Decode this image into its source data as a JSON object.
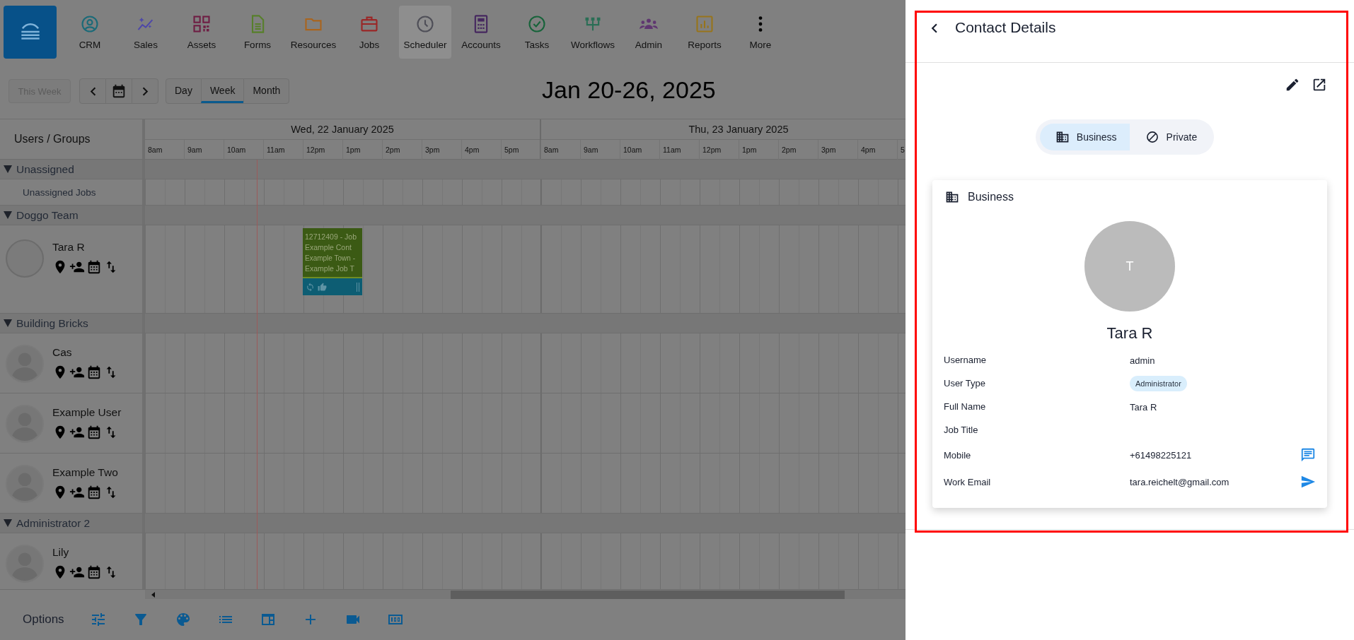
{
  "nav": {
    "items": [
      {
        "label": "CRM",
        "selected": false
      },
      {
        "label": "Sales",
        "selected": false
      },
      {
        "label": "Assets",
        "selected": false
      },
      {
        "label": "Forms",
        "selected": false
      },
      {
        "label": "Resources",
        "selected": false
      },
      {
        "label": "Jobs",
        "selected": false
      },
      {
        "label": "Scheduler",
        "selected": true
      },
      {
        "label": "Accounts",
        "selected": false
      },
      {
        "label": "Tasks",
        "selected": false
      },
      {
        "label": "Workflows",
        "selected": false
      },
      {
        "label": "Admin",
        "selected": false
      },
      {
        "label": "Reports",
        "selected": false
      },
      {
        "label": "More",
        "selected": false
      }
    ]
  },
  "toolbar": {
    "this_week": {
      "label": "This Week",
      "disabled": true
    },
    "views": [
      {
        "label": "Day",
        "selected": false
      },
      {
        "label": "Week",
        "selected": true
      },
      {
        "label": "Month",
        "selected": false
      }
    ],
    "title": "Jan 20-26, 2025"
  },
  "schedule": {
    "users_header": "Users / Groups",
    "days": [
      {
        "label": "Wed, 22 January 2025",
        "hours": [
          "8am",
          "9am",
          "10am",
          "11am",
          "12pm",
          "1pm",
          "2pm",
          "3pm",
          "4pm",
          "5pm"
        ]
      },
      {
        "label": "Thu, 23 January 2025",
        "hours": [
          "8am",
          "9am",
          "10am",
          "11am",
          "12pm",
          "1pm",
          "2pm",
          "3pm",
          "4pm",
          "5"
        ]
      }
    ],
    "groups": [
      {
        "name": "Unassigned",
        "expanded": true,
        "members": [
          {
            "kind": "label",
            "name": "Unassigned Jobs"
          }
        ]
      },
      {
        "name": "Doggo Team",
        "expanded": true,
        "members": [
          {
            "kind": "user",
            "name": "Tara R",
            "silhouette": false,
            "jobs": [
              {
                "lines": [
                  "12712409 - Job",
                  "Example Cont",
                  "Example Town -",
                  "Example Job T"
                ]
              }
            ]
          }
        ]
      },
      {
        "name": "Building Bricks",
        "expanded": true,
        "members": [
          {
            "kind": "user",
            "name": "Cas",
            "silhouette": true
          },
          {
            "kind": "user",
            "name": "Example User",
            "silhouette": true
          },
          {
            "kind": "user",
            "name": "Example Two",
            "silhouette": true
          }
        ]
      },
      {
        "name": "Administrator 2",
        "expanded": true,
        "members": [
          {
            "kind": "user",
            "name": "Lily",
            "silhouette": true
          }
        ]
      }
    ]
  },
  "options": {
    "label": "Options"
  },
  "contact": {
    "title": "Contact Details",
    "tabs": [
      {
        "label": "Business",
        "selected": true
      },
      {
        "label": "Private",
        "selected": false
      }
    ],
    "card_title": "Business",
    "initial": "T",
    "name": "Tara R",
    "fields": [
      {
        "label": "Username",
        "value": "admin",
        "kind": "text"
      },
      {
        "label": "User Type",
        "value": "Administrator",
        "kind": "badge"
      },
      {
        "label": "Full Name",
        "value": "Tara R",
        "kind": "text"
      },
      {
        "label": "Job Title",
        "kind": "text"
      },
      {
        "label": "Mobile",
        "value": "+61498225121",
        "kind": "phone"
      },
      {
        "label": "Work Email",
        "value": "tara.reichelt@gmail.com",
        "kind": "email"
      }
    ]
  }
}
